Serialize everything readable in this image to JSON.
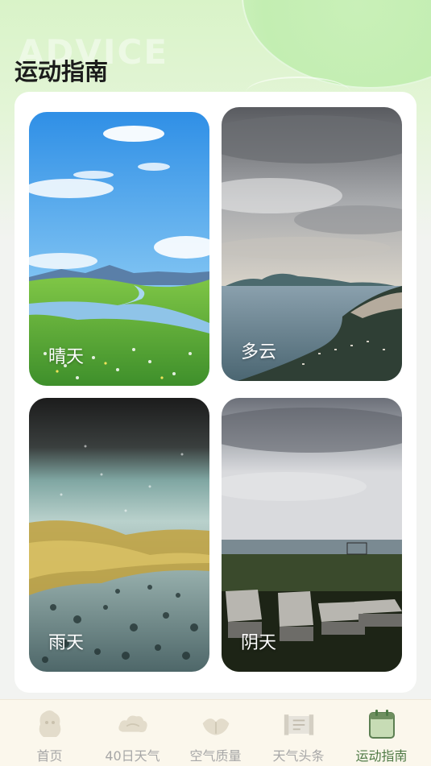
{
  "header": {
    "watermark": "ADVICE",
    "title": "运动指南"
  },
  "tiles": [
    {
      "label": "晴天",
      "scene": "sunny"
    },
    {
      "label": "多云",
      "scene": "cloudy"
    },
    {
      "label": "雨天",
      "scene": "rainy"
    },
    {
      "label": "阴天",
      "scene": "overcast"
    }
  ],
  "tabbar": {
    "items": [
      {
        "label": "首页",
        "icon": "home-icon",
        "active": false
      },
      {
        "label": "40日天气",
        "icon": "cloud-icon",
        "active": false
      },
      {
        "label": "空气质量",
        "icon": "leaf-icon",
        "active": false
      },
      {
        "label": "天气头条",
        "icon": "news-icon",
        "active": false
      },
      {
        "label": "运动指南",
        "icon": "calendar-icon",
        "active": true
      }
    ]
  },
  "colors": {
    "accent": "#4e7a45",
    "inactive": "#a7a7a7",
    "tabbar_bg": "#fbf7ec"
  }
}
